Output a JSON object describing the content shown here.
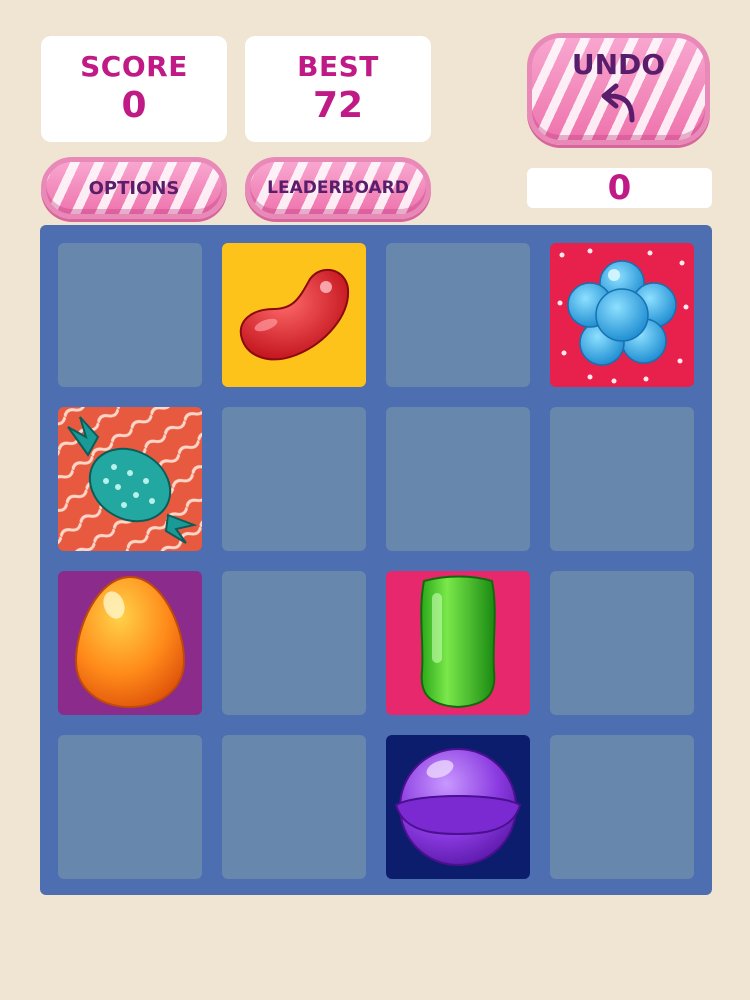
{
  "header": {
    "score": {
      "label": "SCORE",
      "value": "0"
    },
    "best": {
      "label": "BEST",
      "value": "72"
    },
    "undo": {
      "label": "UNDO",
      "icon": "undo-arrow-icon"
    },
    "undo_count": "0"
  },
  "buttons": {
    "options": "OPTIONS",
    "leaderboard": "LEADERBOARD"
  },
  "board": {
    "rows": 4,
    "cols": 4,
    "tiles": [
      {
        "row": 0,
        "col": 1,
        "candy": "red-jellybean",
        "bg": "#fdc31a"
      },
      {
        "row": 0,
        "col": 3,
        "candy": "blue-flower-candy",
        "bg": "#e8204c"
      },
      {
        "row": 1,
        "col": 0,
        "candy": "teal-wrapped-candy",
        "bg": "#e85a40"
      },
      {
        "row": 2,
        "col": 0,
        "candy": "orange-egg-candy",
        "bg": "#8b2b8c"
      },
      {
        "row": 2,
        "col": 2,
        "candy": "green-jelly-candy",
        "bg": "#e8286c"
      },
      {
        "row": 3,
        "col": 2,
        "candy": "purple-lollipop-candy",
        "bg": "#0c1d6e"
      }
    ]
  },
  "colors": {
    "background": "#f0e4d2",
    "accent_text": "#c01a86",
    "board": "#4d6eb0",
    "empty_cell": "#6887ad"
  }
}
